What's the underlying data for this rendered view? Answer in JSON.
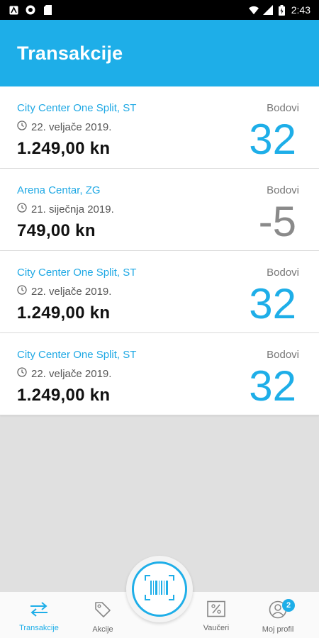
{
  "status_bar": {
    "time": "2:43",
    "left_icons": [
      "app-notification-icon",
      "circle-notification-icon",
      "sd-card-icon"
    ],
    "right_icons": [
      "wifi-icon",
      "signal-icon",
      "battery-icon"
    ]
  },
  "header": {
    "title": "Transakcije"
  },
  "transactions": [
    {
      "store": "City Center One Split, ST",
      "date": "22. veljače 2019.",
      "amount": "1.249,00 kn",
      "points_label": "Bodovi",
      "points": "32",
      "negative": false
    },
    {
      "store": "Arena Centar, ZG",
      "date": "21. siječnja 2019.",
      "amount": "749,00 kn",
      "points_label": "Bodovi",
      "points": "-5",
      "negative": true
    },
    {
      "store": "City Center One Split, ST",
      "date": "22. veljače 2019.",
      "amount": "1.249,00 kn",
      "points_label": "Bodovi",
      "points": "32",
      "negative": false
    },
    {
      "store": "City Center One Split, ST",
      "date": "22. veljače 2019.",
      "amount": "1.249,00 kn",
      "points_label": "Bodovi",
      "points": "32",
      "negative": false
    }
  ],
  "nav": {
    "items": [
      {
        "label": "Transakcije",
        "icon": "transfer-arrows-icon",
        "active": true
      },
      {
        "label": "Akcije",
        "icon": "tag-icon",
        "active": false
      },
      {
        "label": "Vaučeri",
        "icon": "percent-voucher-icon",
        "active": false
      },
      {
        "label": "Moj profil",
        "icon": "profile-icon",
        "active": false
      }
    ],
    "profile_badge": "2",
    "scan_icon": "barcode-scan-icon"
  },
  "colors": {
    "accent": "#1eaee8",
    "negative": "#8a8a8a",
    "background": "#e0e0e0"
  }
}
